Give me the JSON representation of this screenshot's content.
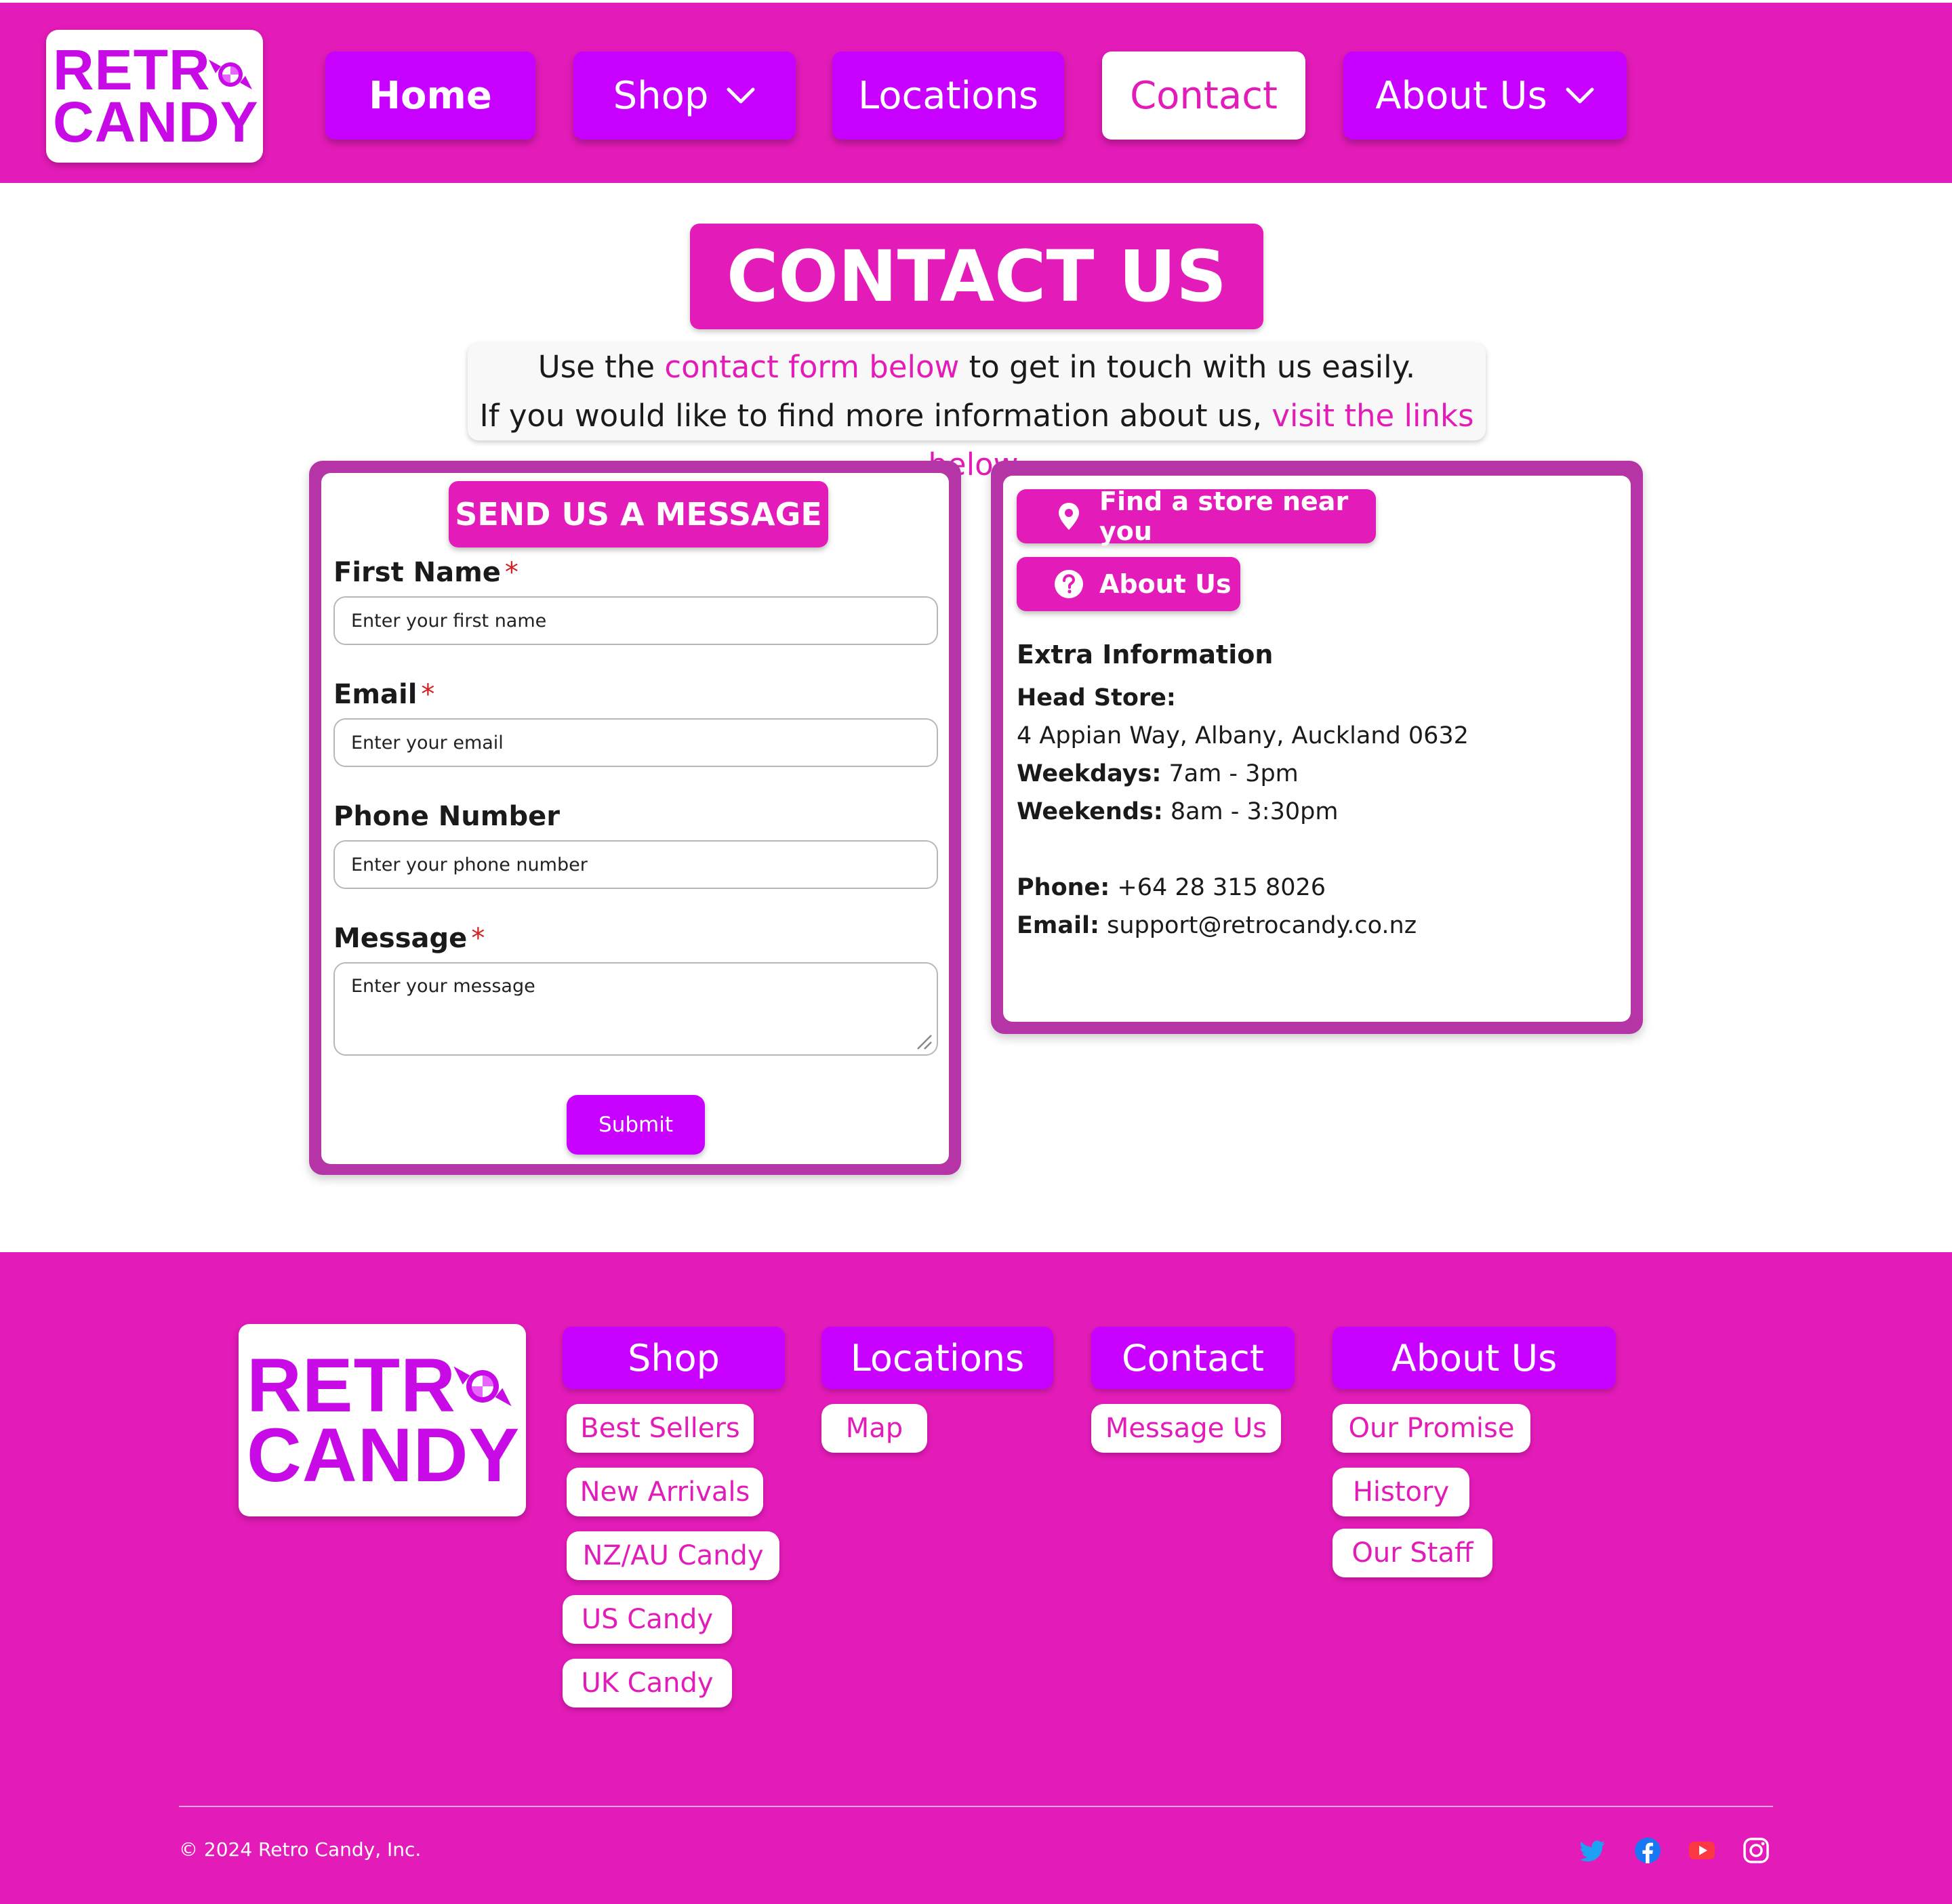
{
  "header": {
    "logo_line1": "RETR",
    "logo_line2": "CANDY",
    "nav": {
      "home": "Home",
      "shop": "Shop",
      "locations": "Locations",
      "contact": "Contact",
      "about": "About Us"
    }
  },
  "main": {
    "title": "CONTACT US",
    "intro": {
      "line1_pre": "Use the ",
      "line1_link": "contact form below",
      "line1_post": " to get in touch with us easily.",
      "line2_pre": "If you would like to find more information about us, ",
      "line2_link": "visit the links below."
    }
  },
  "form": {
    "heading": "SEND US A MESSAGE",
    "required_mark": "*",
    "first_name": {
      "label": "First Name",
      "placeholder": "Enter your first name"
    },
    "email": {
      "label": "Email",
      "placeholder": "Enter your email"
    },
    "phone": {
      "label": "Phone Number",
      "placeholder": "Enter your phone number"
    },
    "message": {
      "label": "Message",
      "placeholder": "Enter your message"
    },
    "submit": "Submit"
  },
  "info": {
    "find_store": "Find a store near you",
    "about_us": "About Us",
    "extra_heading": "Extra Information",
    "head_store_label": "Head Store:",
    "address": "4 Appian Way, Albany, Auckland 0632",
    "weekdays_label": "Weekdays:",
    "weekdays_hours": " 7am - 3pm",
    "weekends_label": "Weekends:",
    "weekends_hours": " 8am - 3:30pm",
    "phone_label": "Phone:",
    "phone_value": " +64 28 315 8026",
    "email_label": "Email:",
    "email_value": " support@retrocandy.co.nz"
  },
  "footer": {
    "logo_line1": "RETR",
    "logo_line2": "CANDY",
    "columns": {
      "shop": {
        "heading": "Shop",
        "links": [
          "Best Sellers",
          "New Arrivals",
          "NZ/AU Candy",
          "US Candy",
          "UK Candy"
        ]
      },
      "locations": {
        "heading": "Locations",
        "links": [
          "Map"
        ]
      },
      "contact": {
        "heading": "Contact",
        "links": [
          "Message Us"
        ]
      },
      "about": {
        "heading": "About Us",
        "links": [
          "Our Promise",
          "History",
          "Our Staff"
        ]
      }
    },
    "copyright": "© 2024 Retro Candy, Inc.",
    "social": [
      "twitter-icon",
      "facebook-icon",
      "youtube-icon",
      "instagram-icon"
    ]
  },
  "colors": {
    "brand_pink": "#e31bb8",
    "brand_purple": "#c800ff",
    "panel_border": "#b535a6",
    "required_red": "#d42020"
  }
}
